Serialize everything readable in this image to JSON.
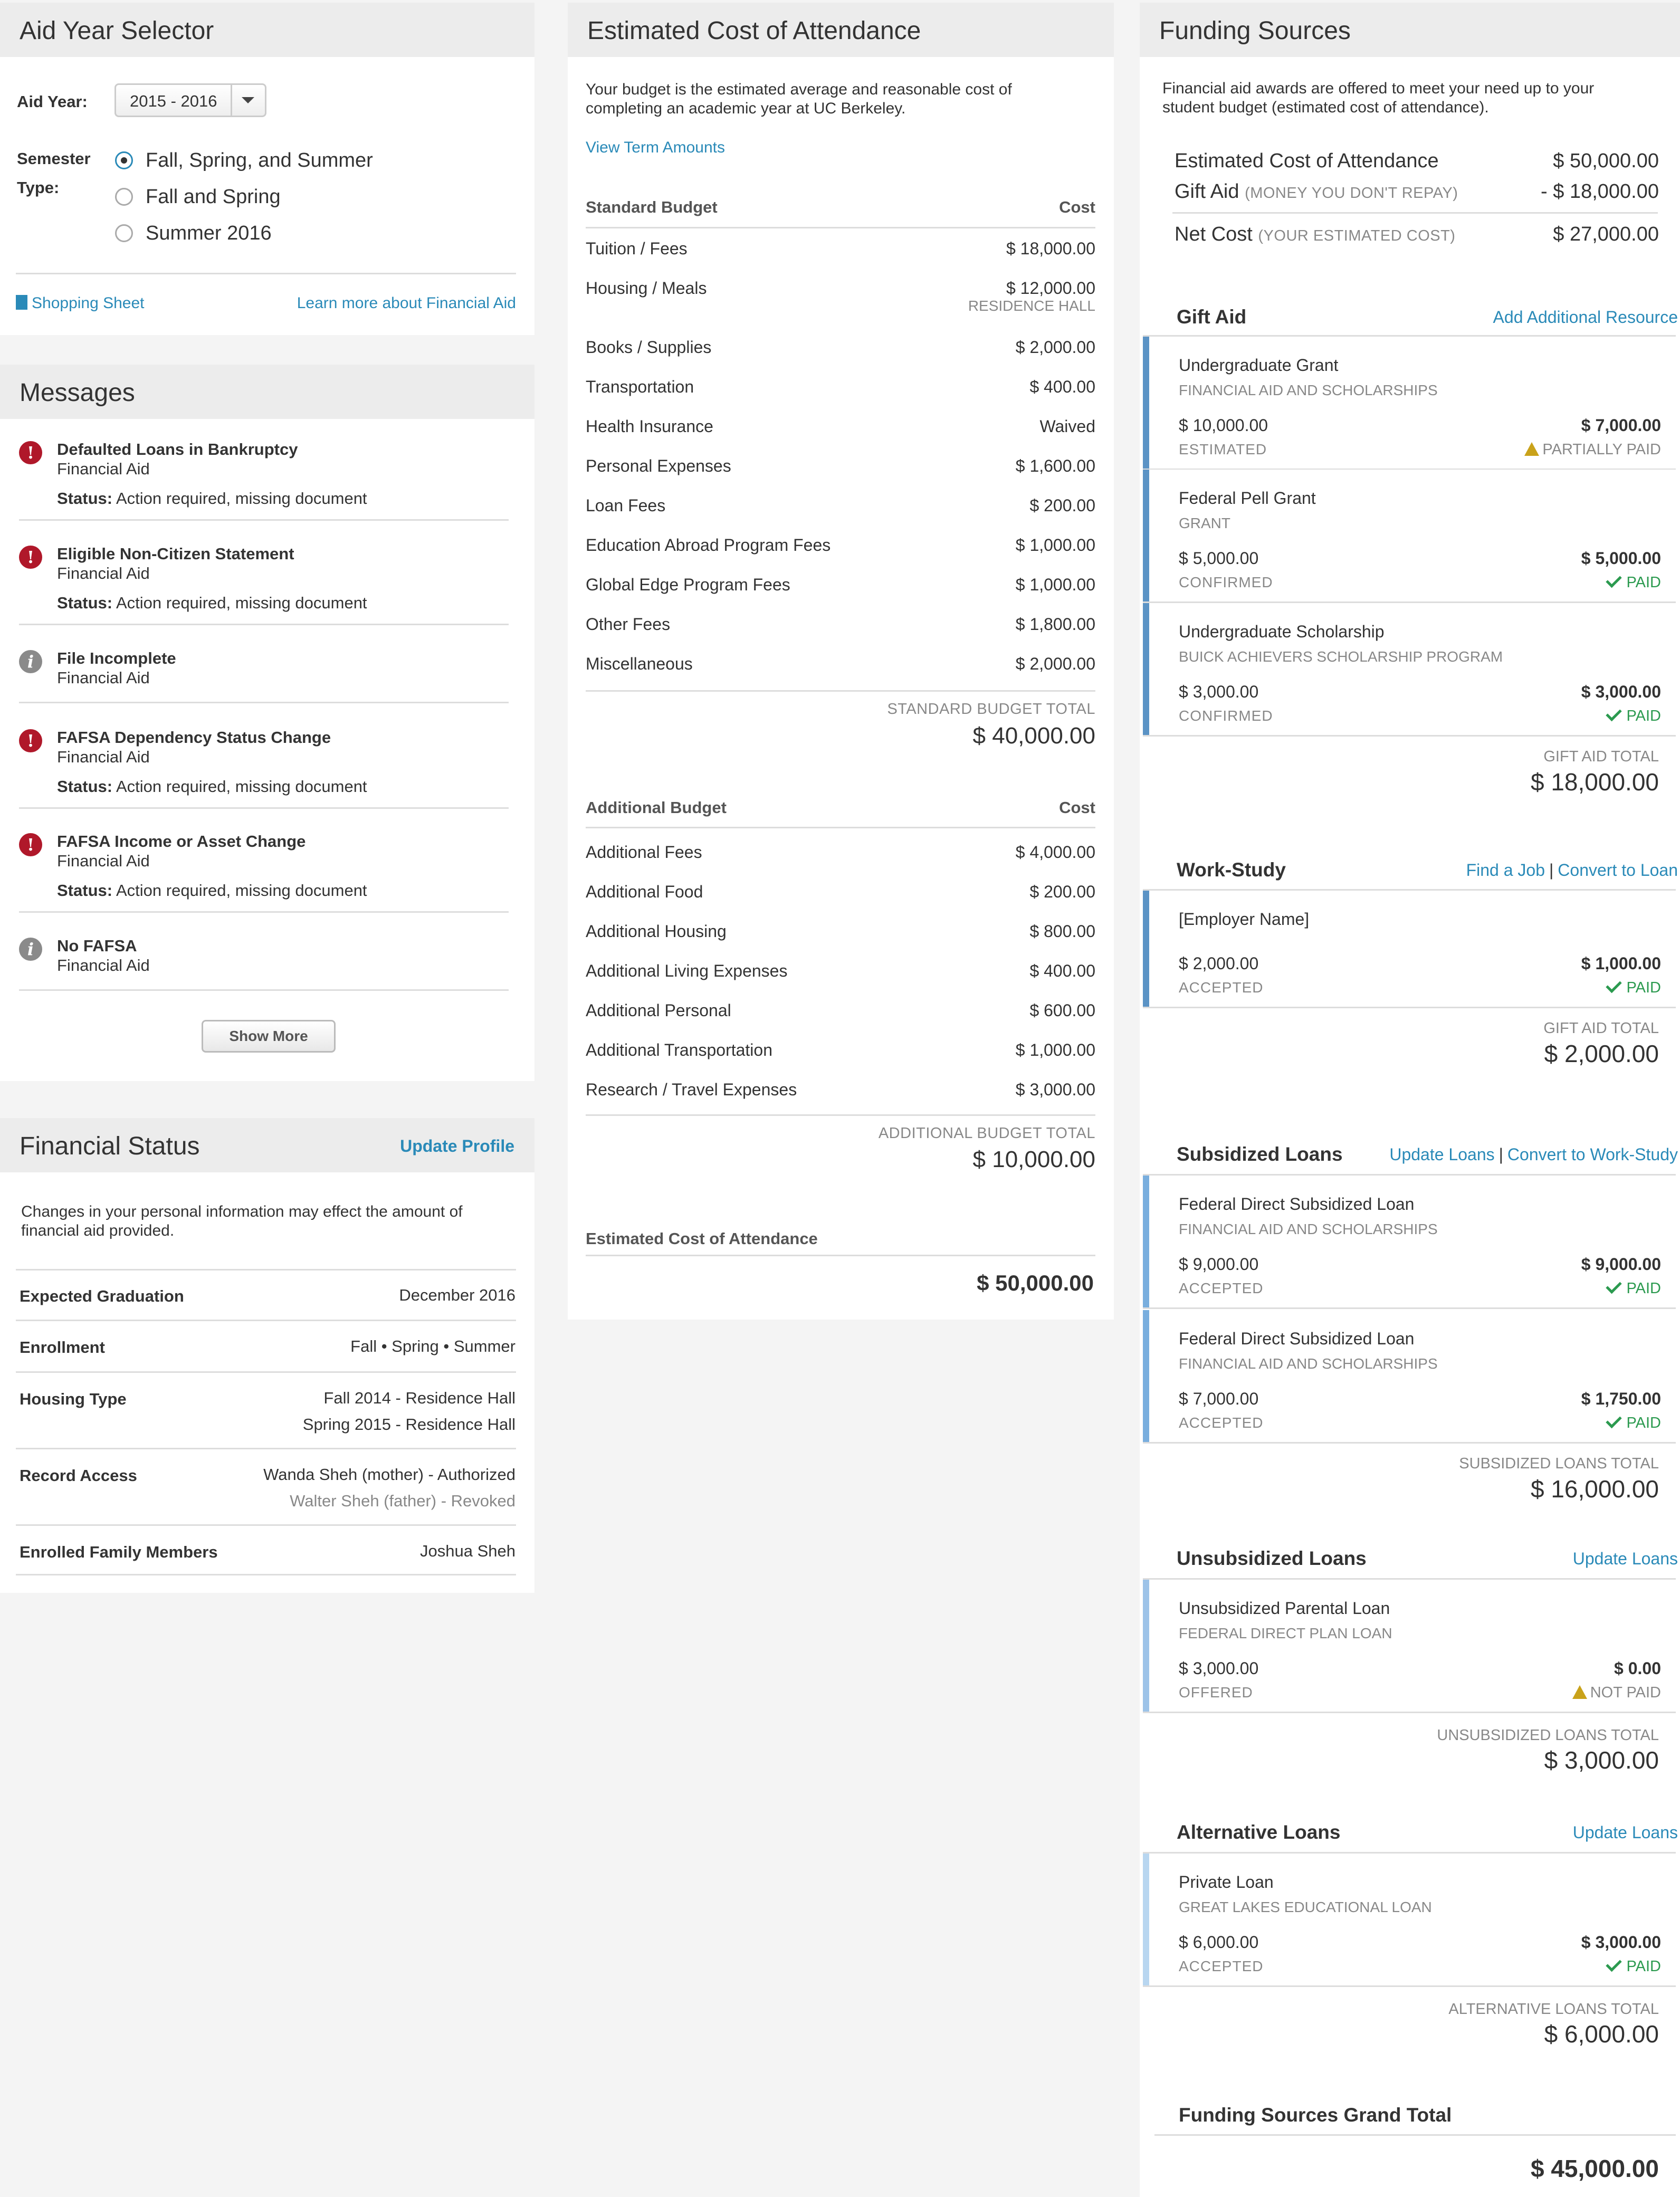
{
  "aid_year_selector": {
    "title": "Aid Year Selector",
    "aid_year_label": "Aid Year:",
    "aid_year_value": "2015 - 2016",
    "semester_label_1": "Semester",
    "semester_label_2": "Type:",
    "options": [
      "Fall, Spring, and Summer",
      "Fall and Spring",
      "Summer 2016"
    ],
    "selected_index": 0,
    "shopping_sheet": "Shopping Sheet",
    "learn_more": "Learn more about Financial Aid"
  },
  "messages": {
    "title": "Messages",
    "items": [
      {
        "icon": "error-icon",
        "title": "Defaulted Loans in Bankruptcy",
        "source": "Financial Aid",
        "status_label": "Status:",
        "status": "Action required, missing document"
      },
      {
        "icon": "error-icon",
        "title": "Eligible Non-Citizen Statement",
        "source": "Financial Aid",
        "status_label": "Status:",
        "status": "Action required, missing document"
      },
      {
        "icon": "info-icon",
        "title": "File Incomplete",
        "source": "Financial Aid",
        "status_label": "",
        "status": ""
      },
      {
        "icon": "error-icon",
        "title": "FAFSA Dependency Status Change",
        "source": "Financial Aid",
        "status_label": "Status:",
        "status": "Action required, missing document"
      },
      {
        "icon": "error-icon",
        "title": "FAFSA Income or Asset Change",
        "source": "Financial Aid",
        "status_label": "Status:",
        "status": "Action required, missing document"
      },
      {
        "icon": "info-icon",
        "title": "No FAFSA",
        "source": "Financial Aid",
        "status_label": "",
        "status": ""
      }
    ],
    "show_more": "Show More"
  },
  "financial_status": {
    "title": "Financial Status",
    "update_profile": "Update Profile",
    "intro": "Changes in your personal information may effect the amount of financial aid provided.",
    "rows": [
      {
        "label": "Expected Graduation",
        "values": [
          "December 2016"
        ]
      },
      {
        "label": "Enrollment",
        "values": [
          "Fall • Spring • Summer"
        ]
      },
      {
        "label": "Housing Type",
        "values": [
          "Fall 2014 - Residence Hall",
          "Spring 2015 - Residence Hall"
        ]
      },
      {
        "label": "Record Access",
        "values": [
          "Wanda Sheh (mother) - Authorized",
          "Walter Sheh (father) - Revoked"
        ]
      },
      {
        "label": "Enrolled Family Members",
        "values": [
          "Joshua Sheh"
        ]
      }
    ]
  },
  "cost_of_attendance": {
    "title": "Estimated Cost of Attendance",
    "intro": "Your budget is the estimated average and reasonable cost of completing an academic year at UC Berkeley.",
    "view_term_amounts": "View Term Amounts",
    "standard": {
      "header": "Standard Budget",
      "cost_header": "Cost",
      "rows": [
        {
          "name": "Tuition / Fees",
          "value": "$ 18,000.00",
          "sub": ""
        },
        {
          "name": "Housing / Meals",
          "value": "$ 12,000.00",
          "sub": "RESIDENCE HALL"
        },
        {
          "name": "Books / Supplies",
          "value": "$ 2,000.00",
          "sub": ""
        },
        {
          "name": "Transportation",
          "value": "$ 400.00",
          "sub": ""
        },
        {
          "name": "Health Insurance",
          "value": "Waived",
          "sub": ""
        },
        {
          "name": "Personal Expenses",
          "value": "$ 1,600.00",
          "sub": ""
        },
        {
          "name": "Loan Fees",
          "value": "$ 200.00",
          "sub": ""
        },
        {
          "name": "Education Abroad Program Fees",
          "value": "$ 1,000.00",
          "sub": ""
        },
        {
          "name": "Global Edge Program Fees",
          "value": "$ 1,000.00",
          "sub": ""
        },
        {
          "name": "Other Fees",
          "value": "$ 1,800.00",
          "sub": ""
        },
        {
          "name": "Miscellaneous",
          "value": "$ 2,000.00",
          "sub": ""
        }
      ],
      "total_label": "STANDARD BUDGET TOTAL",
      "total": "$ 40,000.00"
    },
    "additional": {
      "header": "Additional Budget",
      "cost_header": "Cost",
      "rows": [
        {
          "name": "Additional Fees",
          "value": "$ 4,000.00"
        },
        {
          "name": "Additional Food",
          "value": "$ 200.00"
        },
        {
          "name": "Additional Housing",
          "value": "$ 800.00"
        },
        {
          "name": "Additional Living Expenses",
          "value": "$ 400.00"
        },
        {
          "name": "Additional Personal",
          "value": "$ 600.00"
        },
        {
          "name": "Additional Transportation",
          "value": "$ 1,000.00"
        },
        {
          "name": "Research / Travel Expenses",
          "value": "$ 3,000.00"
        }
      ],
      "total_label": "ADDITIONAL BUDGET TOTAL",
      "total": "$ 10,000.00"
    },
    "grand_label": "Estimated Cost of Attendance",
    "grand_total": "$ 50,000.00"
  },
  "funding": {
    "title": "Funding Sources",
    "intro": "Financial aid awards are offered to meet your need up to your student budget (estimated cost of attendance).",
    "summary": {
      "coa_label": "Estimated Cost of Attendance",
      "coa_value": "$ 50,000.00",
      "gift_label": "Gift Aid",
      "gift_note": "(MONEY YOU DON'T REPAY)",
      "gift_value": "- $ 18,000.00",
      "net_label": "Net Cost",
      "net_note": "(YOUR ESTIMATED COST)",
      "net_value": "$ 27,000.00"
    },
    "gift_aid": {
      "title": "Gift Aid",
      "link1": "Add Additional Resource",
      "awards": [
        {
          "name": "Undergraduate Grant",
          "sub": "FINANCIAL AID AND SCHOLARSHIPS",
          "amount": "$ 10,000.00",
          "state": "ESTIMATED",
          "paid": "$ 7,000.00",
          "pay_status": "PARTIALLY PAID",
          "pay_icon": "warning-icon"
        },
        {
          "name": "Federal Pell Grant",
          "sub": "GRANT",
          "amount": "$ 5,000.00",
          "state": "CONFIRMED",
          "paid": "$ 5,000.00",
          "pay_status": "PAID",
          "pay_icon": "check-icon"
        },
        {
          "name": "Undergraduate Scholarship",
          "sub": "BUICK ACHIEVERS SCHOLARSHIP PROGRAM",
          "amount": "$ 3,000.00",
          "state": "CONFIRMED",
          "paid": "$ 3,000.00",
          "pay_status": "PAID",
          "pay_icon": "check-icon"
        }
      ],
      "total_label": "GIFT AID TOTAL",
      "total": "$ 18,000.00"
    },
    "work_study": {
      "title": "Work-Study",
      "link1": "Find a Job",
      "sep": "|",
      "link2": "Convert to Loan",
      "awards": [
        {
          "name": "[Employer Name]",
          "sub": "",
          "amount": "$ 2,000.00",
          "state": "ACCEPTED",
          "paid": "$ 1,000.00",
          "pay_status": "PAID",
          "pay_icon": "check-icon"
        }
      ],
      "total_label": "GIFT AID TOTAL",
      "total": "$ 2,000.00"
    },
    "subsidized": {
      "title": "Subsidized Loans",
      "link1": "Update Loans",
      "sep": "|",
      "link2": "Convert  to Work-Study",
      "awards": [
        {
          "name": "Federal Direct Subsidized Loan",
          "sub": "FINANCIAL AID AND SCHOLARSHIPS",
          "amount": "$ 9,000.00",
          "state": "ACCEPTED",
          "paid": "$ 9,000.00",
          "pay_status": "PAID",
          "pay_icon": "check-icon"
        },
        {
          "name": "Federal Direct Subsidized Loan",
          "sub": "FINANCIAL AID AND SCHOLARSHIPS",
          "amount": "$ 7,000.00",
          "state": "ACCEPTED",
          "paid": "$ 1,750.00",
          "pay_status": "PAID",
          "pay_icon": "check-icon"
        }
      ],
      "total_label": "SUBSIDIZED LOANS TOTAL",
      "total": "$ 16,000.00"
    },
    "unsubsidized": {
      "title": "Unsubsidized Loans",
      "link1": "Update Loans",
      "awards": [
        {
          "name": "Unsubsidized Parental Loan",
          "sub": "FEDERAL DIRECT PLAN LOAN",
          "amount": "$ 3,000.00",
          "state": "OFFERED",
          "paid": "$ 0.00",
          "pay_status": "NOT PAID",
          "pay_icon": "warning-icon"
        }
      ],
      "total_label": "UNSUBSIDIZED LOANS TOTAL",
      "total": "$ 3,000.00"
    },
    "alternative": {
      "title": "Alternative Loans",
      "link1": "Update Loans",
      "awards": [
        {
          "name": "Private Loan",
          "sub": "GREAT LAKES EDUCATIONAL LOAN",
          "amount": "$ 6,000.00",
          "state": "ACCEPTED",
          "paid": "$ 3,000.00",
          "pay_status": "PAID",
          "pay_icon": "check-icon"
        }
      ],
      "total_label": "ALTERNATIVE LOANS TOTAL",
      "total": "$ 6,000.00"
    },
    "grand_label": "Funding Sources Grand Total",
    "grand_total": "$ 45,000.00"
  },
  "colors": {
    "link": "#2a8ab8",
    "error": "#b0182a",
    "paid": "#2b9a4f",
    "warning": "#c9a21a",
    "award_bar": "#5b93c5"
  }
}
